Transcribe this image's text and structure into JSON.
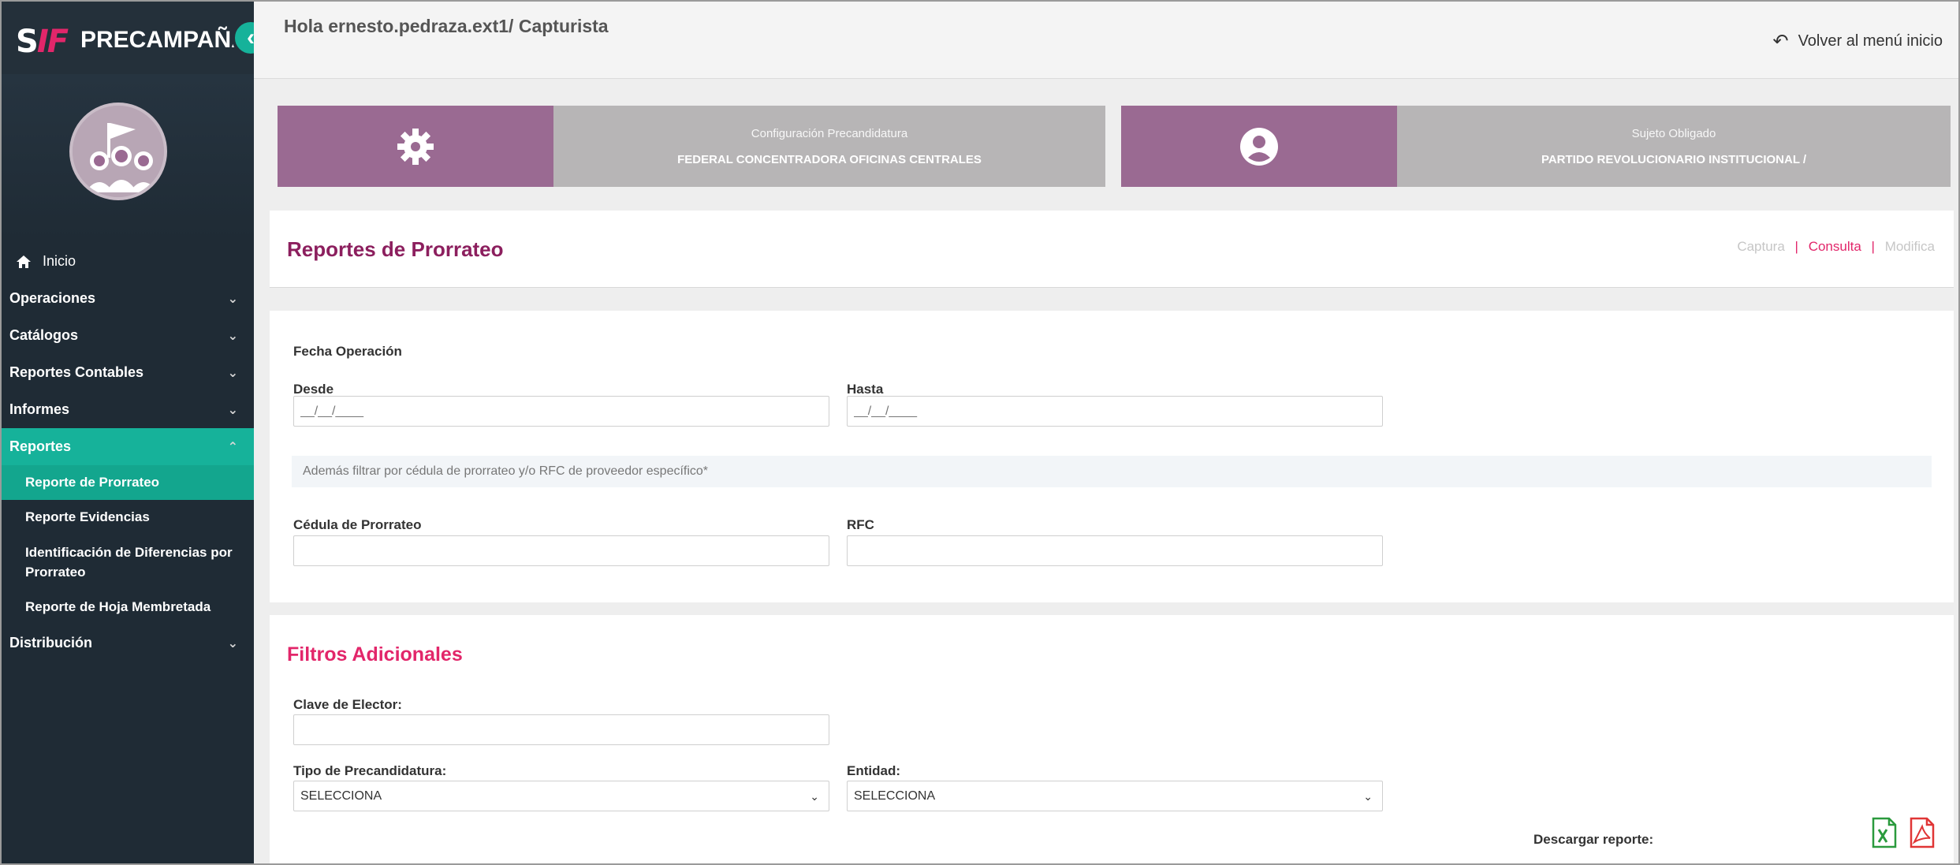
{
  "brand": {
    "logo_s": "S",
    "logo_if": "IF",
    "title": "PRECAMPAÑA"
  },
  "sidebar": {
    "home_label": "Inicio",
    "items": [
      {
        "label": "Operaciones"
      },
      {
        "label": "Catálogos"
      },
      {
        "label": "Reportes Contables"
      },
      {
        "label": "Informes"
      }
    ],
    "active_item": "Reportes",
    "subitems": [
      {
        "label": "Reporte de Prorrateo"
      },
      {
        "label": "Reporte Evidencias"
      },
      {
        "label": "Identificación de Diferencias por Prorrateo"
      },
      {
        "label": "Reporte de Hoja Membretada"
      }
    ],
    "last_item": "Distribución"
  },
  "header": {
    "greeting": "Hola ernesto.pedraza.ext1/ Capturista",
    "back_label": "Volver al menú inicio"
  },
  "cards": [
    {
      "caption": "Configuración Precandidatura",
      "value": "FEDERAL CONCENTRADORA OFICINAS CENTRALES",
      "icon": "gear-icon"
    },
    {
      "caption": "Sujeto Obligado",
      "value": "PARTIDO REVOLUCIONARIO INSTITUCIONAL /",
      "icon": "user-circle-icon"
    }
  ],
  "page": {
    "title": "Reportes de Prorrateo",
    "breadcrumb": {
      "first": "Captura",
      "active": "Consulta",
      "last": "Modifica"
    }
  },
  "form": {
    "fecha_label": "Fecha Operación",
    "desde_label": "Desde",
    "desde_placeholder": "__/__/____",
    "hasta_label": "Hasta",
    "hasta_placeholder": "__/__/____",
    "hint": "Además filtrar por cédula de prorrateo y/o RFC de proveedor específico*",
    "cedula_label": "Cédula de Prorrateo",
    "cedula_value": "",
    "rfc_label": "RFC",
    "rfc_value": ""
  },
  "filters": {
    "title": "Filtros Adicionales",
    "clave_label": "Clave de Elector:",
    "clave_value": "",
    "tipo_label": "Tipo de Precandidatura:",
    "tipo_selected": "SELECCIONA",
    "entidad_label": "Entidad:",
    "entidad_selected": "SELECCIONA",
    "download_label": "Descargar reporte:"
  },
  "colors": {
    "sidebar": "#1f2b35",
    "accent_teal": "#16b29a",
    "accent_pink": "#e2266a",
    "title_purple": "#8c1f5e",
    "card_purple": "#9a6a92",
    "card_grey": "#b7b5b6"
  }
}
